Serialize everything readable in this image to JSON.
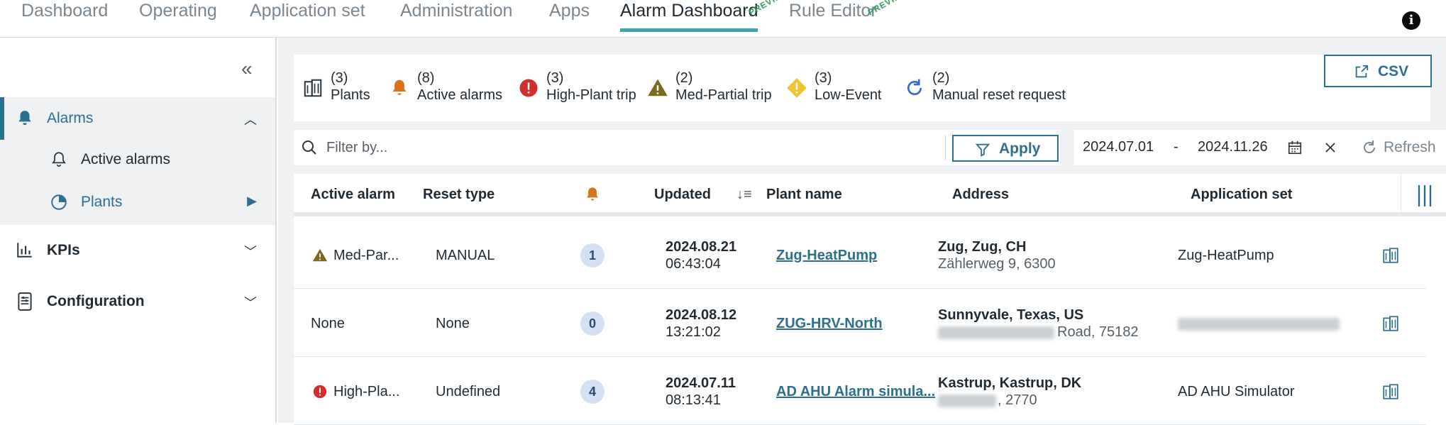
{
  "nav": {
    "tabs": [
      "Dashboard",
      "Operating",
      "Application set",
      "Administration",
      "Apps",
      "Alarm Dashboard",
      "Rule Editor"
    ],
    "preview_tag": "PREVIEW"
  },
  "sidebar": {
    "alarms": "Alarms",
    "active_alarms": "Active alarms",
    "plants": "Plants",
    "kpis": "KPIs",
    "configuration": "Configuration"
  },
  "summary": [
    {
      "count": "(3)",
      "label": "Plants",
      "icon": "building-icon"
    },
    {
      "count": "(8)",
      "label": "Active alarms",
      "icon": "bell-icon"
    },
    {
      "count": "(3)",
      "label": "High-Plant trip",
      "icon": "error-circle-icon"
    },
    {
      "count": "(2)",
      "label": "Med-Partial trip",
      "icon": "warning-triangle-icon"
    },
    {
      "count": "(3)",
      "label": "Low-Event",
      "icon": "warning-diamond-icon"
    },
    {
      "count": "(2)",
      "label": "Manual reset request",
      "icon": "refresh-icon"
    }
  ],
  "csv_label": "CSV",
  "filter": {
    "placeholder": "Filter by...",
    "apply_label": "Apply"
  },
  "date_range": {
    "from": "2024.07.01",
    "separator": "-",
    "to": "2024.11.26"
  },
  "refresh_label": "Refresh",
  "table": {
    "headers": [
      "Active alarm",
      "Reset type",
      "Updated",
      "Plant name",
      "Address",
      "Application set"
    ],
    "rows": [
      {
        "alarm": "Med-Par...",
        "alarm_icon": "warning-triangle-icon",
        "reset": "MANUAL",
        "count": "1",
        "date": "2024.08.21",
        "time": "06:43:04",
        "plant": "Zug-HeatPump",
        "addr1": "Zug, Zug, CH",
        "addr2": "Zählerweg 9, 6300",
        "appset": "Zug-HeatPump"
      },
      {
        "alarm": "None",
        "alarm_icon": "",
        "reset": "None",
        "count": "0",
        "date": "2024.08.12",
        "time": "13:21:02",
        "plant": "ZUG-HRV-North",
        "addr1": "Sunnyvale, Texas, US",
        "addr2": "Road, 75182",
        "appset": ""
      },
      {
        "alarm": "High-Pla...",
        "alarm_icon": "error-circle-icon",
        "reset": "Undefined",
        "count": "4",
        "date": "2024.07.11",
        "time": "08:13:41",
        "plant": "AD AHU Alarm simula...",
        "addr1": "Kastrup, Kastrup, DK",
        "addr2": ", 2770",
        "appset": "AD AHU Simulator"
      }
    ]
  }
}
